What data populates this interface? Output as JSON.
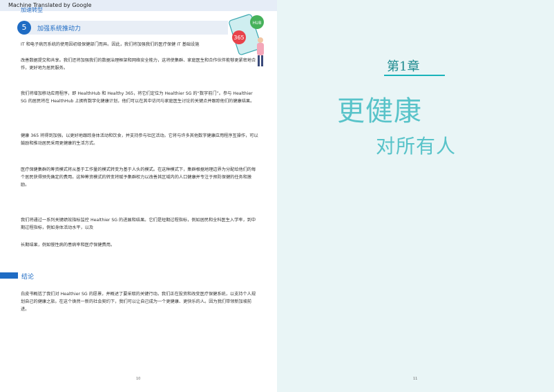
{
  "banner": {
    "text": "Machine Translated by Google",
    "prev_section": "加速转型"
  },
  "section": {
    "number": "5",
    "title": "加强系统推动力"
  },
  "left_page": {
    "paragraphs": [
      "IT 和电子病历系统的使用因初级保健部门而异。因此，我们将加强我们的医疗保健 IT 基础设施",
      "改善数据提交和共享。我们还将加强我们的数据治理框架和网络安全能力，这将使集群、家庭医生和合作伙伴能够更紧密地合作，更好地为居民服务。",
      "我们将增加移动应用程序，即 HealthHub 和 Healthy 365，将它们定位为 Healthier SG 的“数字前门”。参与 Healthier SG 的居民将在 HealthHub 上拥有数字化健康计划，他们可以在其中访问与家庭医生讨论的关键点并跟踪他们的健康结果。",
      "健康 365 将得到加强，以更好地跟踪身体活动和饮食，并支持参与社区活动。它将与许多其他数字健康应用程序互操作，可以鼓励和推动居民采用更健康的生活方式。",
      "医疗保健集群的筹资模式将从基于工作量的模式转变为基于人头的模式。在这种模式下，集群根据地理边界为分配给他们的每个居民获得预先确定的费用。这种筹资模式的转变将赋予集群权力以改善其区域内的人口健康并专注于预防保健的任务和激励。",
      "我们将通过一系列关键绩效指标监控 Healthier SG 的进展和结果。它们是短期过程指标，例如居民和全科医生入学率，到中期过程指标，例如身体活动水平，以及",
      "长期结果，例如慢性病的患病率和医疗保健费用。"
    ],
    "conclusion_title": "结论",
    "conclusion_text": "白皮书概括了我们对 Healthier SG 的愿景，并概述了要采取的关键行动。我们正在投资和改变医疗保健系统，以支持个人规划自己的健康之旅。在这个焕然一新的社会契约下，我们可以让自己成为一个更健康、更快乐的人。因为我们带领新加坡前进。",
    "page_number": "10"
  },
  "right_page": {
    "chapter": "第1章",
    "title_line1": "更健康",
    "title_line2": "对所有人",
    "page_number": "11"
  },
  "illustration": {
    "badge_365": "365",
    "badge_hub": "HUB"
  },
  "colors": {
    "accent_blue": "#1f6cc4",
    "teal": "#58c3c9",
    "teal_dark": "#1d8a8f",
    "right_bg": "#e9f5f6"
  }
}
